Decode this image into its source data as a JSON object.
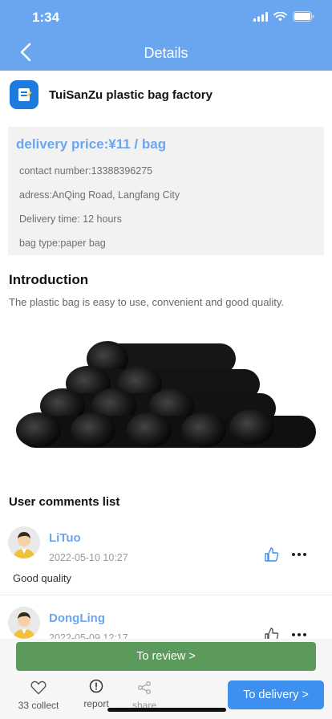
{
  "status_bar": {
    "time": "1:34"
  },
  "nav": {
    "title": "Details"
  },
  "shop": {
    "name": "TuiSanZu plastic bag factory"
  },
  "info": {
    "price": "delivery price:¥11 / bag",
    "contact": "contact number:13388396275",
    "address": "adress:AnQing Road, Langfang City",
    "delivery_time": "Delivery time: 12 hours",
    "bag_type": "bag type:paper bag"
  },
  "intro": {
    "title": "Introduction",
    "text": "The plastic bag is easy to use, convenient and good quality."
  },
  "comments": {
    "title": "User comments list",
    "items": [
      {
        "name": "LiTuo",
        "date": "2022-05-10 10:27",
        "text": "Good quality"
      },
      {
        "name": "DongLing",
        "date": "2022-05-09 12:17",
        "text": ""
      }
    ]
  },
  "bottom": {
    "review_label": "To review >",
    "collect_label": "33 collect",
    "report_label": "report",
    "share_label": "share",
    "delivery_label": "To delivery >"
  },
  "colors": {
    "header": "#6aa6f0",
    "accent_blue": "#3d90f0",
    "review_green": "#5b9a5b"
  },
  "icons": [
    "back-arrow-icon",
    "signal-icon",
    "wifi-icon",
    "battery-icon",
    "shop-logo-icon",
    "thumbs-up-icon",
    "more-dots-icon",
    "heart-icon",
    "report-icon",
    "share-icon"
  ]
}
